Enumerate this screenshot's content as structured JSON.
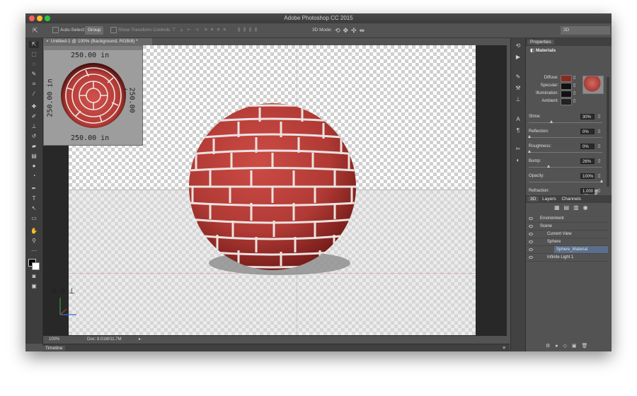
{
  "app": {
    "title": "Adobe Photoshop CC 2015"
  },
  "options_bar": {
    "auto_select_label": "Auto-Select:",
    "auto_select_value": "Group",
    "transform_label": "Show Transform Controls",
    "mode_3d_label": "3D Mode:",
    "workspace_value": "3D"
  },
  "document": {
    "tab_label": "Untitled-1 @ 100% (Background, RGB/8) *",
    "zoom": "100%",
    "doc_size": "Doc: 8.01M/11.7M"
  },
  "thumbnail": {
    "top_label": "250.00 in",
    "bottom_label": "250.00 in",
    "left_label": "250.00 in",
    "right_label": "250.00 in"
  },
  "timeline": {
    "label": "Timeline"
  },
  "properties": {
    "panel_title": "Properties",
    "section": "Materials",
    "swatches": [
      {
        "label": "Diffuse:",
        "color": "#8b2a1e"
      },
      {
        "label": "Specular:",
        "color": "#111111"
      },
      {
        "label": "Illumination:",
        "color": "#111111"
      },
      {
        "label": "Ambient:",
        "color": "#222222"
      }
    ],
    "params": [
      {
        "label": "Shine:",
        "value": "30%",
        "level": 0.3
      },
      {
        "label": "Reflection:",
        "value": "0%",
        "level": 0.0
      },
      {
        "label": "Roughness:",
        "value": "0%",
        "level": 0.0
      },
      {
        "label": "Bump:",
        "value": "26%",
        "level": 0.26
      },
      {
        "label": "Opacity:",
        "value": "100%",
        "level": 1.0
      },
      {
        "label": "Refraction:",
        "value": "1.000",
        "level": 0.0
      }
    ]
  },
  "layers_panel": {
    "tabs": [
      "3D",
      "Layers",
      "Channels"
    ],
    "rows": [
      {
        "label": "Environment",
        "indent": 0
      },
      {
        "label": "Scene",
        "indent": 0
      },
      {
        "label": "Current View",
        "indent": 1
      },
      {
        "label": "Sphere",
        "indent": 1
      },
      {
        "label": "Sphere_Material",
        "indent": 2,
        "selected": true
      },
      {
        "label": "Infinite Light 1",
        "indent": 1
      }
    ]
  },
  "colors": {
    "accent_selected": "#5b6f8c",
    "brick": "#b53a35",
    "mortar": "#e6dcda"
  }
}
